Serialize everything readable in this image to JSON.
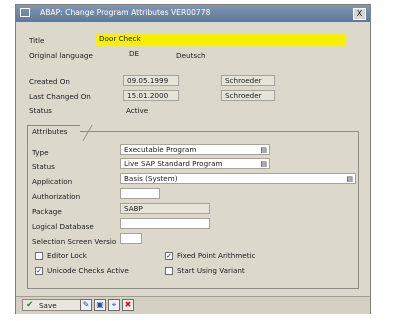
{
  "window": {
    "title": "ABAP: Change Program Attributes VER00778",
    "close_glyph": "X"
  },
  "header": {
    "title_label": "Title",
    "title_value": "Door Check",
    "orig_lang_label": "Original language",
    "orig_lang_code": "DE",
    "orig_lang_name": "Deutsch",
    "created_label": "Created On",
    "created_date": "09.05.1999",
    "created_by": "Schroeder",
    "changed_label": "Last Changed On",
    "changed_date": "15.01.2000",
    "changed_by": "Schroeder",
    "status_label": "Status",
    "status_value": "Active"
  },
  "attributes": {
    "group_label": "Attributes",
    "type_label": "Type",
    "type_value": "Executable Program",
    "status_label": "Status",
    "status_value": "Live SAP Standard Program",
    "application_label": "Application",
    "application_value": "Basis (System)",
    "authorization_label": "Authorization",
    "authorization_value": "",
    "package_label": "Package",
    "package_value": "SABP",
    "logical_db_label": "Logical Database",
    "logical_db_value": "",
    "selection_screen_label": "Selection Screen Versio",
    "selection_screen_value": "",
    "checkboxes": {
      "editor_lock": {
        "label": "Editor Lock",
        "checked": false
      },
      "fixed_point": {
        "label": "Fixed Point Arithmetic",
        "checked": true
      },
      "unicode": {
        "label": "Unicode Checks Active",
        "checked": true
      },
      "start_variant": {
        "label": "Start Using Variant",
        "checked": false
      }
    }
  },
  "toolbar": {
    "save_label": "Save",
    "icons": [
      "check-icon",
      "edit-icon",
      "display-icon",
      "cancel-icon"
    ]
  },
  "colors": {
    "title_field": "#f7f000",
    "titlebar": "#6f88a6",
    "background": "#dcd9cc"
  }
}
